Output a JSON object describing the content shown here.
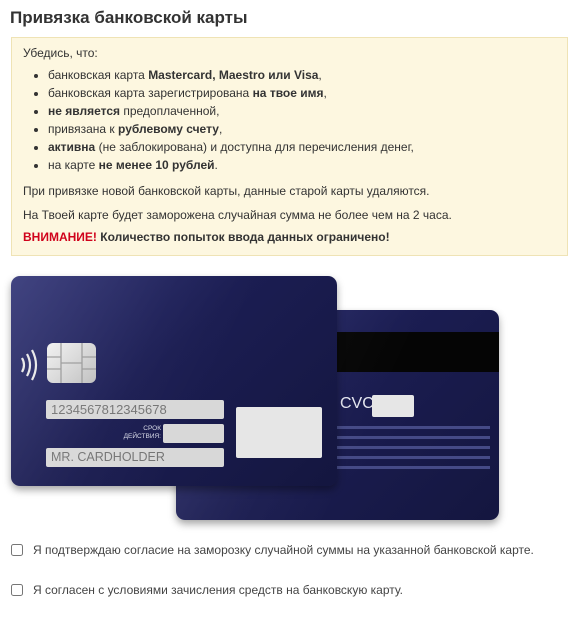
{
  "page": {
    "title": "Привязка банковской карты"
  },
  "notice": {
    "intro": "Убедись, что:",
    "items": [
      {
        "pre": "банковская карта ",
        "bold": "Mastercard, Maestro или Visa",
        "post": ","
      },
      {
        "pre": "банковская карта зарегистрирована ",
        "bold": "на твое имя",
        "post": ","
      },
      {
        "pre": "",
        "bold": "не является",
        "post": " предоплаченной,"
      },
      {
        "pre": "привязана к ",
        "bold": "рублевому счету",
        "post": ","
      },
      {
        "pre": "",
        "bold": "активна",
        "post": " (не заблокирована) и доступна для перечисления денег,"
      },
      {
        "pre": "на карте ",
        "bold": "не менее 10 рублей",
        "post": "."
      }
    ],
    "p1": "При привязке новой банковской карты, данные старой карты удаляются.",
    "p2": "На Твоей карте будет заморожена случайная сумма не более чем на 2 часа.",
    "warning_label": "ВНИМАНИЕ!",
    "warning_text": " Количество попыток ввода данных ограничено!"
  },
  "card_front": {
    "number_placeholder": "1234567812345678",
    "expiry_label_line1": "СРОК",
    "expiry_label_line2": "ДЕЙСТВИЯ:",
    "expiry_placeholder": "",
    "name_placeholder": "MR. CARDHOLDER"
  },
  "card_back": {
    "cvc_label": "CVC",
    "cvc_value": ""
  },
  "agreements": [
    {
      "label": "Я подтверждаю согласие на заморозку случайной суммы на указанной банковской карте.",
      "checked": false
    },
    {
      "label": "Я согласен с условиями зачисления средств на банковскую карту.",
      "checked": false
    }
  ],
  "colors": {
    "card": "#1f2259",
    "notice_bg": "#fdf7e0",
    "warning": "#d0021b"
  },
  "icons": {
    "contactless": "contactless-icon",
    "chip": "chip-icon"
  }
}
